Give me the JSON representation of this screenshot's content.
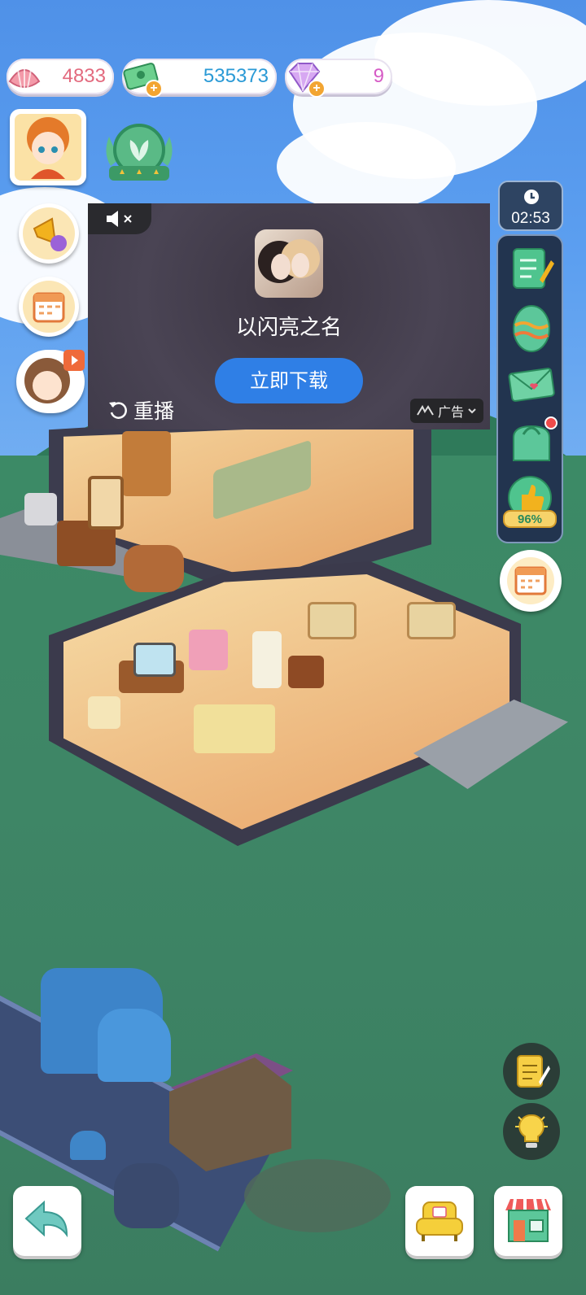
{
  "hud": {
    "shells": "4833",
    "cash": "535373",
    "gems": "9",
    "shell_color": "#e36a7e",
    "cash_color": "#2a9ad6",
    "gem_color": "#d65bc6"
  },
  "ad": {
    "app_name": "以闪亮之名",
    "download_label": "立即下载",
    "replay_label": "重播",
    "ad_tag": "广告",
    "button_color": "#2f7fe6"
  },
  "sidebar": {
    "timer": "02:53",
    "rating": "96%"
  },
  "icons": {
    "left": [
      "megaphone-icon",
      "calendar-icon",
      "live-tv-icon"
    ],
    "right": [
      "task-list-icon",
      "egg-icon",
      "mail-icon",
      "bag-icon",
      "thumbs-up-icon",
      "calendar-icon"
    ],
    "bottom": [
      "back-arrow-icon",
      "armchair-icon",
      "shop-icon"
    ],
    "float": [
      "notepad-icon",
      "lightbulb-icon"
    ]
  }
}
